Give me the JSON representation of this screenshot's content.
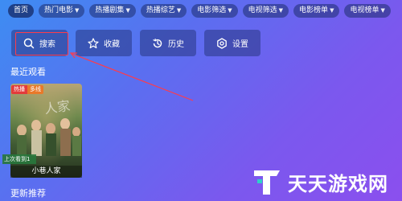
{
  "nav": {
    "items": [
      {
        "label": "首页",
        "dropdown": false
      },
      {
        "label": "热门电影",
        "dropdown": true
      },
      {
        "label": "热播剧集",
        "dropdown": true
      },
      {
        "label": "热播综艺",
        "dropdown": true
      },
      {
        "label": "电影筛选",
        "dropdown": true
      },
      {
        "label": "电视筛选",
        "dropdown": true
      },
      {
        "label": "电影榜单",
        "dropdown": true
      },
      {
        "label": "电视榜单",
        "dropdown": true
      }
    ]
  },
  "actions": {
    "search": "搜索",
    "favorites": "收藏",
    "history": "历史",
    "settings": "设置"
  },
  "sections": {
    "recent": "最近观看",
    "updates": "更新推荐"
  },
  "recent_item": {
    "badge_hot": "热播",
    "badge_tag": "多线",
    "poster_art_text": "人家",
    "progress": "上次看到1",
    "name": "小巷人家"
  },
  "watermark": {
    "text": "天天游戏网"
  },
  "colors": {
    "highlight": "#ff3b4a",
    "badge_hot": "#e33b3b",
    "badge_tag": "#e8792a"
  }
}
